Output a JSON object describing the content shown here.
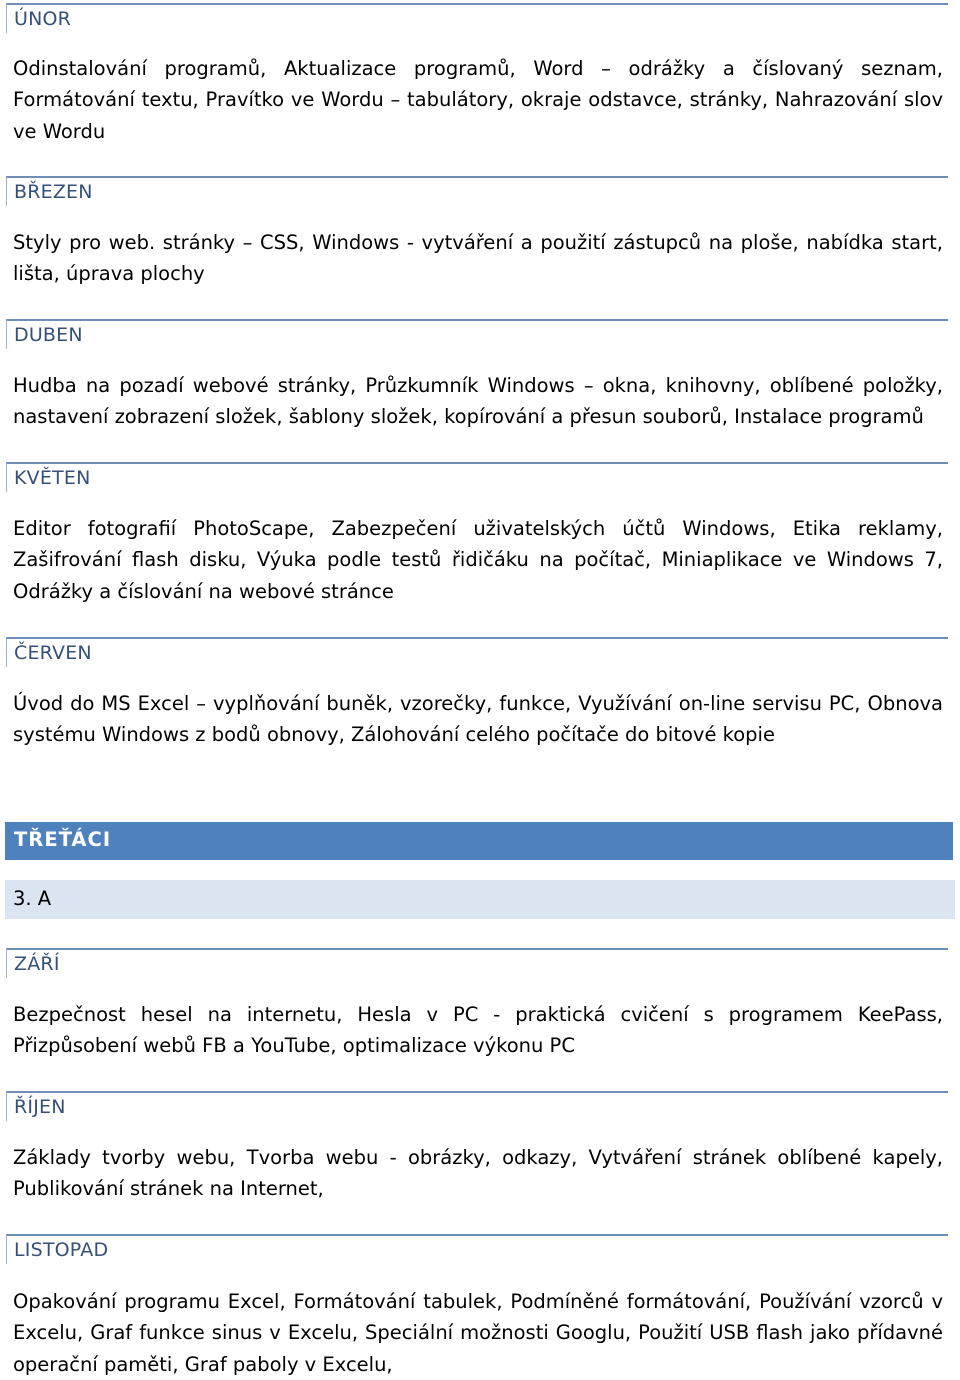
{
  "sections_before": [
    {
      "month": "ÚNOR",
      "text": "Odinstalování programů, Aktualizace programů, Word – odrážky a číslovaný seznam, Formátování textu, Pravítko ve Wordu – tabulátory, okraje odstavce, stránky, Nahrazování slov ve Wordu"
    },
    {
      "month": "BŘEZEN",
      "text": "Styly pro web. stránky – CSS, Windows - vytváření a použití zástupců na ploše, nabídka start, lišta, úprava plochy"
    },
    {
      "month": "DUBEN",
      "text": "Hudba na pozadí webové stránky, Průzkumník Windows – okna, knihovny, oblíbené položky, nastavení zobrazení složek, šablony složek, kopírování a přesun souborů, Instalace programů"
    },
    {
      "month": "KVĚTEN",
      "text": "Editor fotografií PhotoScape, Zabezpečení uživatelských účtů Windows, Etika reklamy, Zašifrování flash disku, Výuka podle testů řidičáku na počítač, Miniaplikace ve Windows 7, Odrážky a číslování na webové stránce"
    },
    {
      "month": "ČERVEN",
      "text": "Úvod do MS Excel – vyplňování buněk, vzorečky, funkce, Využívání on-line servisu PC, Obnova systému Windows z bodů obnovy, Zálohování celého počítače do bitové kopie"
    }
  ],
  "group": {
    "title": "TŘEŤÁCI",
    "class_label": "3. A",
    "colors": {
      "group_bar": "#4f81bd",
      "class_bar": "#dbe5f1",
      "month_text": "#35507a"
    }
  },
  "sections_after": [
    {
      "month": "ZÁŘÍ",
      "text": "Bezpečnost hesel na internetu, Hesla v PC - praktická cvičení s programem KeePass, Přizpůsobení webů FB a YouTube, optimalizace výkonu PC"
    },
    {
      "month": "ŘÍJEN",
      "text": "Základy tvorby webu, Tvorba webu - obrázky, odkazy, Vytváření stránek oblíbené kapely, Publikování stránek na Internet,"
    },
    {
      "month": "LISTOPAD",
      "text": "Opakování programu Excel, Formátování tabulek, Podmíněné formátování, Používání vzorců v Excelu, Graf funkce sinus v Excelu, Speciální možnosti Googlu, Použití USB flash jako přídavné operační paměti, Graf paboly v Excelu,"
    }
  ]
}
